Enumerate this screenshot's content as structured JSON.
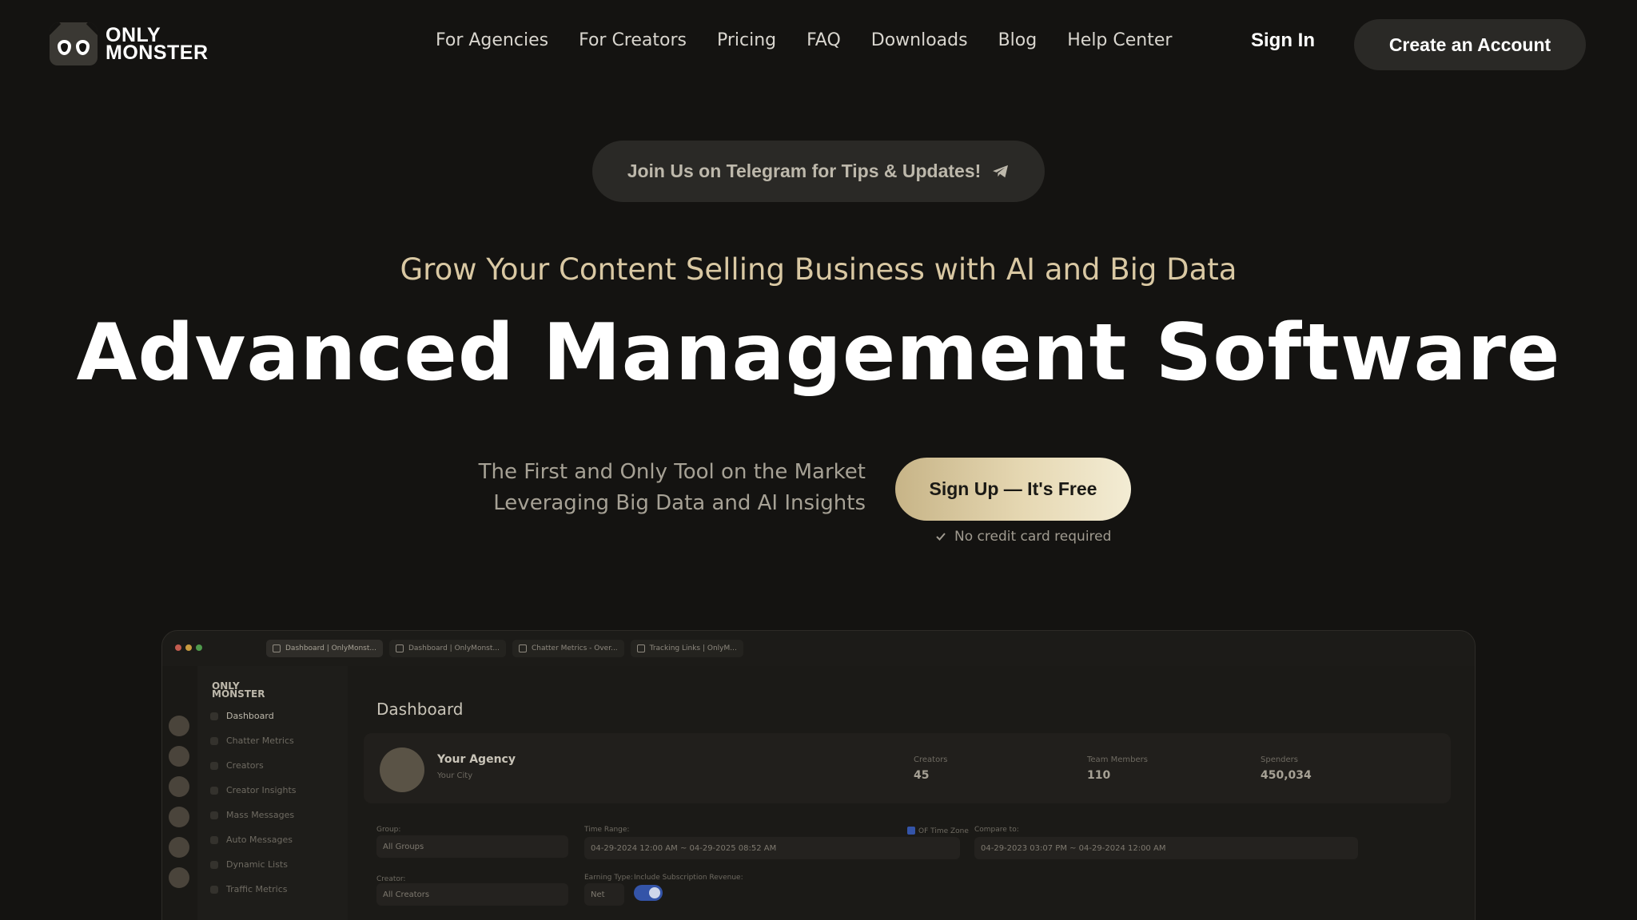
{
  "header": {
    "logo_line1": "ONLY",
    "logo_line2": "MONSTER",
    "nav": [
      "For Agencies",
      "For Creators",
      "Pricing",
      "FAQ",
      "Downloads",
      "Blog",
      "Help Center"
    ],
    "sign_in": "Sign In",
    "create_account": "Create an Account"
  },
  "hero": {
    "telegram_cta": "Join Us on Telegram for Tips & Updates!",
    "tagline": "Grow Your Content Selling Business with AI and Big Data",
    "title": "Advanced Management Software",
    "sub_line1": "The First and Only Tool on the Market",
    "sub_line2": "Leveraging Big Data and AI Insights",
    "signup": "Sign Up — It's Free",
    "no_credit": "No credit card required"
  },
  "preview": {
    "tabs": [
      "Dashboard | OnlyMonst...",
      "Dashboard | OnlyMonst...",
      "Chatter Metrics - Over...",
      "Tracking Links | OnlyM..."
    ],
    "sidebar_logo_line1": "ONLY",
    "sidebar_logo_line2": "MONSTER",
    "sidebar_items": [
      "Dashboard",
      "Chatter Metrics",
      "Creators",
      "Creator Insights",
      "Mass Messages",
      "Auto Messages",
      "Dynamic Lists",
      "Traffic Metrics"
    ],
    "dashboard_title": "Dashboard",
    "agency_name": "Your Agency",
    "agency_city": "Your City",
    "stats": [
      {
        "label": "Creators",
        "value": "45"
      },
      {
        "label": "Team Members",
        "value": "110"
      },
      {
        "label": "Spenders",
        "value": "450,034"
      }
    ],
    "filters": {
      "group_label": "Group:",
      "group_value": "All Groups",
      "creator_label": "Creator:",
      "creator_value": "All Creators",
      "time_range_label": "Time Range:",
      "time_range_value": "04-29-2024 12:00 AM ~ 04-29-2025 08:52 AM",
      "of_time_zone": "OF Time Zone",
      "compare_label": "Compare to:",
      "compare_value": "04-29-2023 03:07 PM ~ 04-29-2024 12:00 AM",
      "earning_type_label": "Earning Type:",
      "earning_type_value": "Net",
      "include_sub_label": "Include Subscription Revenue:"
    }
  },
  "colors": {
    "background": "#141311",
    "accent_gold": "#d9c8a3",
    "button_dark": "#2a2926"
  }
}
